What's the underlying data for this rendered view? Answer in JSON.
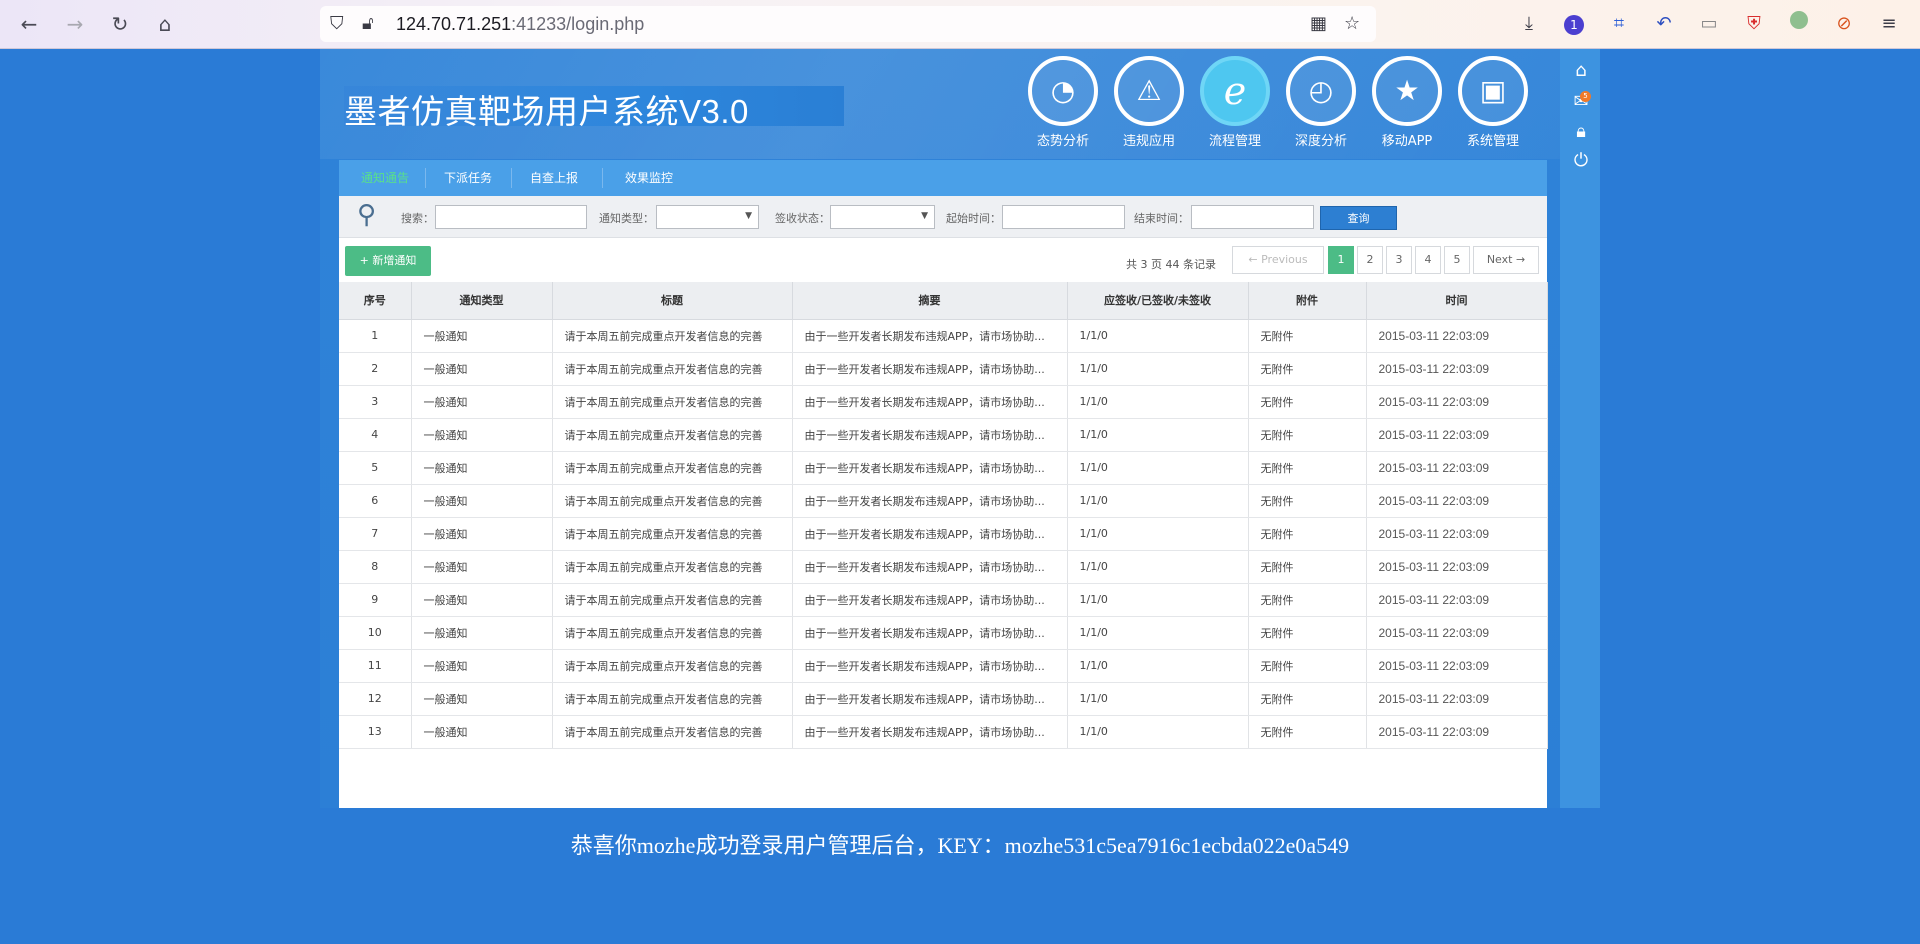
{
  "browser": {
    "url_host": "124.70.71.251",
    "url_rest": ":41233/login.php"
  },
  "app": {
    "title": "墨者仿真靶场用户系统V3.0",
    "top_icons": [
      {
        "label": "态势分析",
        "icon": "pie-chart-icon"
      },
      {
        "label": "违规应用",
        "icon": "warning-icon"
      },
      {
        "label": "流程管理",
        "icon": "ie-browser-icon"
      },
      {
        "label": "深度分析",
        "icon": "gauge-icon"
      },
      {
        "label": "移动APP",
        "icon": "star-badge-icon"
      },
      {
        "label": "系统管理",
        "icon": "picture-icon"
      }
    ],
    "mail_badge": "5",
    "tabs": [
      "通知通告",
      "下派任务",
      "自查上报",
      "效果监控"
    ],
    "filters": {
      "search_label": "搜索：",
      "type_label": "通知类型：",
      "sign_label": "签收状态：",
      "start_label": "起始时间：",
      "end_label": "结束时间：",
      "query_button": "查询"
    },
    "add_button": "+ 新增通知",
    "page_info": "共 3 页 44 条记录",
    "pager": {
      "prev": "← Previous",
      "pages": [
        "1",
        "2",
        "3",
        "4",
        "5"
      ],
      "next": "Next →",
      "current": "1"
    },
    "table": {
      "headers": [
        "序号",
        "通知类型",
        "标题",
        "摘要",
        "应签收/已签收/未签收",
        "附件",
        "时间"
      ],
      "rows": [
        [
          "1",
          "一般通知",
          "请于本周五前完成重点开发者信息的完善",
          "由于一些开发者长期发布违规APP，请市场协助...",
          "1/1/0",
          "无附件",
          "2015-03-11 22:03:09"
        ],
        [
          "2",
          "一般通知",
          "请于本周五前完成重点开发者信息的完善",
          "由于一些开发者长期发布违规APP，请市场协助...",
          "1/1/0",
          "无附件",
          "2015-03-11 22:03:09"
        ],
        [
          "3",
          "一般通知",
          "请于本周五前完成重点开发者信息的完善",
          "由于一些开发者长期发布违规APP，请市场协助...",
          "1/1/0",
          "无附件",
          "2015-03-11 22:03:09"
        ],
        [
          "4",
          "一般通知",
          "请于本周五前完成重点开发者信息的完善",
          "由于一些开发者长期发布违规APP，请市场协助...",
          "1/1/0",
          "无附件",
          "2015-03-11 22:03:09"
        ],
        [
          "5",
          "一般通知",
          "请于本周五前完成重点开发者信息的完善",
          "由于一些开发者长期发布违规APP，请市场协助...",
          "1/1/0",
          "无附件",
          "2015-03-11 22:03:09"
        ],
        [
          "6",
          "一般通知",
          "请于本周五前完成重点开发者信息的完善",
          "由于一些开发者长期发布违规APP，请市场协助...",
          "1/1/0",
          "无附件",
          "2015-03-11 22:03:09"
        ],
        [
          "7",
          "一般通知",
          "请于本周五前完成重点开发者信息的完善",
          "由于一些开发者长期发布违规APP，请市场协助...",
          "1/1/0",
          "无附件",
          "2015-03-11 22:03:09"
        ],
        [
          "8",
          "一般通知",
          "请于本周五前完成重点开发者信息的完善",
          "由于一些开发者长期发布违规APP，请市场协助...",
          "1/1/0",
          "无附件",
          "2015-03-11 22:03:09"
        ],
        [
          "9",
          "一般通知",
          "请于本周五前完成重点开发者信息的完善",
          "由于一些开发者长期发布违规APP，请市场协助...",
          "1/1/0",
          "无附件",
          "2015-03-11 22:03:09"
        ],
        [
          "10",
          "一般通知",
          "请于本周五前完成重点开发者信息的完善",
          "由于一些开发者长期发布违规APP，请市场协助...",
          "1/1/0",
          "无附件",
          "2015-03-11 22:03:09"
        ],
        [
          "11",
          "一般通知",
          "请于本周五前完成重点开发者信息的完善",
          "由于一些开发者长期发布违规APP，请市场协助...",
          "1/1/0",
          "无附件",
          "2015-03-11 22:03:09"
        ],
        [
          "12",
          "一般通知",
          "请于本周五前完成重点开发者信息的完善",
          "由于一些开发者长期发布违规APP，请市场协助...",
          "1/1/0",
          "无附件",
          "2015-03-11 22:03:09"
        ],
        [
          "13",
          "一般通知",
          "请于本周五前完成重点开发者信息的完善",
          "由于一些开发者长期发布违规APP，请市场协助...",
          "1/1/0",
          "无附件",
          "2015-03-11 22:03:09"
        ]
      ]
    }
  },
  "success_message": "恭喜你mozhe成功登录用户管理后台，KEY：mozhe531c5ea7916c1ecbda022e0a549"
}
